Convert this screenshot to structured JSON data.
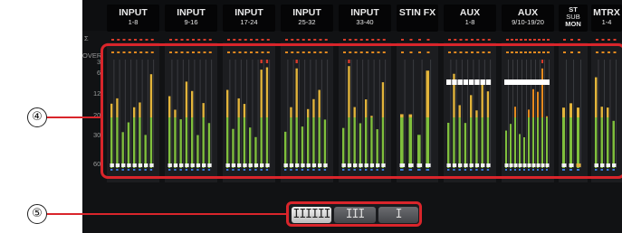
{
  "groups": [
    {
      "line1": "INPUT",
      "line2": "1-8"
    },
    {
      "line1": "INPUT",
      "line2": "9-16"
    },
    {
      "line1": "INPUT",
      "line2": "17-24"
    },
    {
      "line1": "INPUT",
      "line2": "25-32"
    },
    {
      "line1": "INPUT",
      "line2": "33-40"
    },
    {
      "line1": "STIN FX",
      "line2": ""
    },
    {
      "line1": "AUX",
      "line2": "1-8"
    },
    {
      "line1": "AUX",
      "line2": "9/10-19/20"
    },
    {
      "line1": "ST",
      "line2": "SUB",
      "line3": "MON"
    },
    {
      "line1": "MTRX",
      "line2": "1-4"
    }
  ],
  "scale": {
    "sigma": "Σ",
    "over": "OVER",
    "m3": "3",
    "m6": "6",
    "m12": "12",
    "m20": "20",
    "m30": "30",
    "m60": "60"
  },
  "segments": {
    "option1": "IIIIII",
    "option2": "III",
    "option3": "I",
    "selected": "option1"
  },
  "callouts": {
    "meters": "④",
    "width_selector": "⑤"
  },
  "colors": {
    "accent": "#d9252b",
    "meter_green": "#7fbf3c",
    "meter_yellow": "#e2b43a",
    "meter_red": "#d93b2b",
    "meter_orange": "#e58a1f"
  }
}
